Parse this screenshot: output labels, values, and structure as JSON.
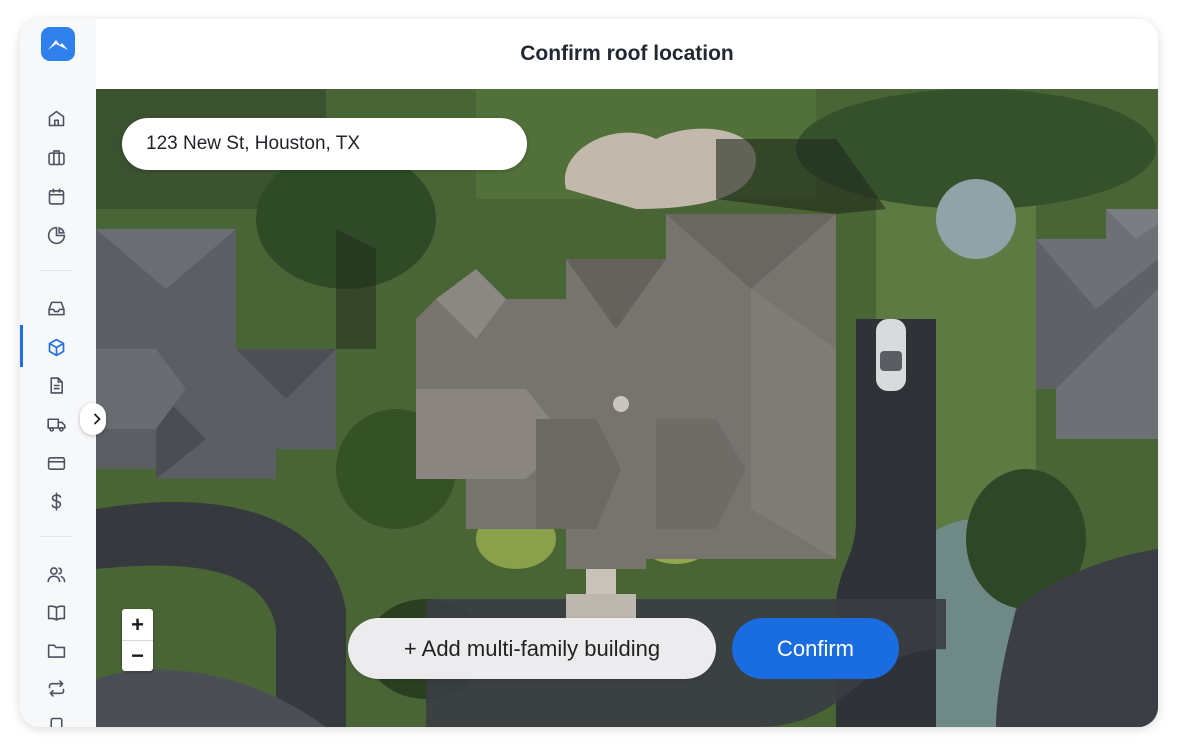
{
  "header": {
    "title": "Confirm roof location"
  },
  "search": {
    "value": "123 New St, Houston, TX"
  },
  "zoom": {
    "in_label": "+",
    "out_label": "−"
  },
  "actions": {
    "add_building_label": "+ Add multi-family building",
    "confirm_label": "Confirm"
  },
  "sidebar": {
    "items": [
      {
        "name": "home-icon"
      },
      {
        "name": "briefcase-icon"
      },
      {
        "name": "calendar-icon"
      },
      {
        "name": "pie-chart-icon"
      },
      {
        "name": "inbox-icon"
      },
      {
        "name": "cube-icon",
        "active": true
      },
      {
        "name": "document-icon"
      },
      {
        "name": "truck-icon"
      },
      {
        "name": "credit-card-icon"
      },
      {
        "name": "dollar-icon"
      },
      {
        "name": "users-icon"
      },
      {
        "name": "book-icon"
      },
      {
        "name": "folder-icon"
      },
      {
        "name": "repeat-icon"
      }
    ]
  },
  "colors": {
    "accent": "#1a6de0",
    "logo": "#2f80ed"
  }
}
